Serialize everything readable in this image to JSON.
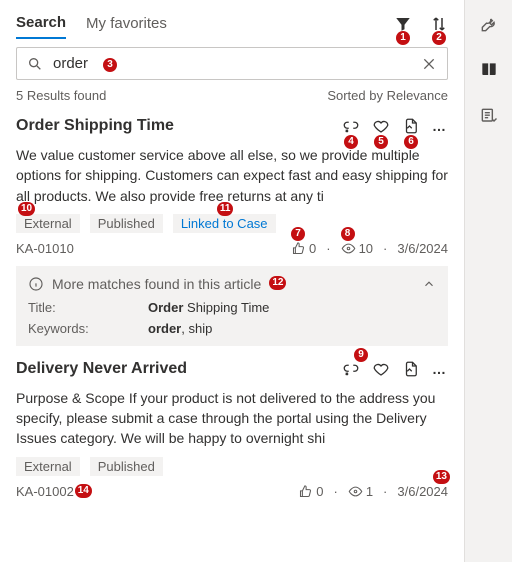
{
  "tabs": {
    "search": "Search",
    "favorites": "My favorites"
  },
  "search": {
    "value": "order",
    "placeholder": "Search"
  },
  "results": {
    "count": "5 Results found",
    "sort": "Sorted by Relevance"
  },
  "badges": {
    "filter": "1",
    "sort": "2",
    "searchbox": "3",
    "a1_unlink": "4",
    "a1_fav": "5",
    "a1_link": "6",
    "a1_likes": "7",
    "a1_views": "8",
    "tag_external": "10",
    "tag_linked": "11",
    "more": "12",
    "a2_unlink": "9",
    "a2_date": "13",
    "a2_id": "14"
  },
  "article1": {
    "title": "Order Shipping Time",
    "excerpt": "We value customer service above all else, so we provide multiple options for shipping. Customers can expect fast and easy shipping for all products. We also provide free returns at any ti",
    "tags": {
      "external": "External",
      "published": "Published",
      "linked": "Linked to Case"
    },
    "id": "KA-01010",
    "likes": "0",
    "views": "10",
    "date": "3/6/2024",
    "more_label": "More matches found in this article",
    "fields": {
      "title_label": "Title:",
      "title_value_bold": "Order",
      "title_value_rest": " Shipping Time",
      "keywords_label": "Keywords:",
      "keywords_value_bold": "order",
      "keywords_value_rest": ", ship"
    }
  },
  "article2": {
    "title": "Delivery Never Arrived",
    "excerpt": "Purpose & Scope If your product is not delivered to the address you specify, please submit a case through the portal using the Delivery Issues category. We will be happy to overnight shi",
    "tags": {
      "external": "External",
      "published": "Published"
    },
    "id": "KA-01002",
    "likes": "0",
    "views": "1",
    "date": "3/6/2024"
  },
  "dot": "·"
}
